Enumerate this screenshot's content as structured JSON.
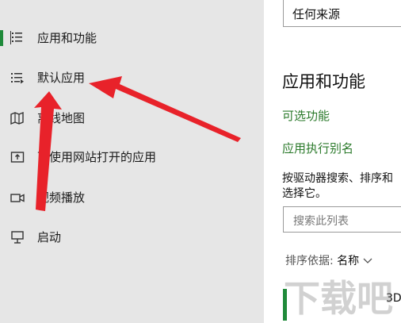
{
  "sidebar": {
    "items": [
      {
        "label": "应用和功能",
        "icon": "apps-features-icon",
        "active": true
      },
      {
        "label": "默认应用",
        "icon": "default-apps-icon"
      },
      {
        "label": "离线地图",
        "icon": "offline-maps-icon"
      },
      {
        "label": "可使用网站打开的应用",
        "icon": "apps-for-websites-icon"
      },
      {
        "label": "视频播放",
        "icon": "video-playback-icon"
      },
      {
        "label": "启动",
        "icon": "startup-icon"
      }
    ]
  },
  "main": {
    "source_dropdown": {
      "value": "任何来源"
    },
    "section_title": "应用和功能",
    "optional_features_link": "可选功能",
    "app_execution_alias_link": "应用执行别名",
    "description_line1": "按驱动器搜索、排序和",
    "description_line2": "选择它。",
    "search_placeholder": "搜索此列表",
    "sort_label": "排序依据:",
    "sort_value": "名称",
    "list_item_name": "3D",
    "watermark_text": "下载吧"
  },
  "colors": {
    "sidebar_bg": "#e6e6e6",
    "accent": "#1f8a3a",
    "link": "#2b7a2b",
    "arrow": "#e8222a"
  }
}
